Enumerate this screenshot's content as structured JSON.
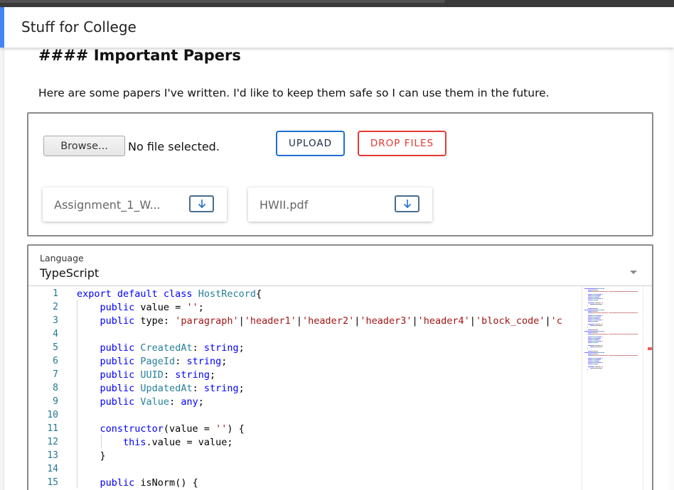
{
  "header": {
    "title": "Stuff for College"
  },
  "main": {
    "heading": "#### Important Papers",
    "intro": "Here are some papers I've written. I'd like to keep them safe so I can use them in the future."
  },
  "upload": {
    "browse_label": "Browse...",
    "no_file_text": "No file selected.",
    "upload_label": "UPLOAD",
    "drop_label": "DROP FILES",
    "files": [
      {
        "name": "Assignment_1_W...",
        "icon": "download-arrow-icon"
      },
      {
        "name": "HWII.pdf",
        "icon": "download-arrow-icon"
      }
    ]
  },
  "editor": {
    "language_label": "Language",
    "language_value": "TypeScript",
    "line_numbers": [
      "1",
      "2",
      "3",
      "4",
      "5",
      "6",
      "7",
      "8",
      "9",
      "10",
      "11",
      "12",
      "13",
      "14",
      "15"
    ],
    "code_lines": [
      [
        [
          "kw",
          "export default class "
        ],
        [
          "ty",
          "HostRecord"
        ],
        [
          "",
          "{"
        ]
      ],
      [
        [
          "",
          "    "
        ],
        [
          "kw",
          "public "
        ],
        [
          "",
          "value = "
        ],
        [
          "st",
          "''"
        ],
        [
          "",
          ";"
        ]
      ],
      [
        [
          "",
          "    "
        ],
        [
          "kw",
          "public "
        ],
        [
          "",
          "type: "
        ],
        [
          "st",
          "'paragraph'"
        ],
        [
          "",
          "|"
        ],
        [
          "st",
          "'header1'"
        ],
        [
          "",
          "|"
        ],
        [
          "st",
          "'header2'"
        ],
        [
          "",
          "|"
        ],
        [
          "st",
          "'header3'"
        ],
        [
          "",
          "|"
        ],
        [
          "st",
          "'header4'"
        ],
        [
          "",
          "|"
        ],
        [
          "st",
          "'block_code'"
        ],
        [
          "",
          "|"
        ],
        [
          "st",
          "'c"
        ]
      ],
      [],
      [
        [
          "",
          "    "
        ],
        [
          "kw",
          "public "
        ],
        [
          "ty",
          "CreatedAt"
        ],
        [
          "",
          ": "
        ],
        [
          "kw",
          "string"
        ],
        [
          "",
          ";"
        ]
      ],
      [
        [
          "",
          "    "
        ],
        [
          "kw",
          "public "
        ],
        [
          "ty",
          "PageId"
        ],
        [
          "",
          ": "
        ],
        [
          "kw",
          "string"
        ],
        [
          "",
          ";"
        ]
      ],
      [
        [
          "",
          "    "
        ],
        [
          "kw",
          "public "
        ],
        [
          "ty",
          "UUID"
        ],
        [
          "",
          ": "
        ],
        [
          "kw",
          "string"
        ],
        [
          "",
          ";"
        ]
      ],
      [
        [
          "",
          "    "
        ],
        [
          "kw",
          "public "
        ],
        [
          "ty",
          "UpdatedAt"
        ],
        [
          "",
          ": "
        ],
        [
          "kw",
          "string"
        ],
        [
          "",
          ";"
        ]
      ],
      [
        [
          "",
          "    "
        ],
        [
          "kw",
          "public "
        ],
        [
          "ty",
          "Value"
        ],
        [
          "",
          ": "
        ],
        [
          "kw",
          "any"
        ],
        [
          "",
          ";"
        ]
      ],
      [],
      [
        [
          "",
          "    "
        ],
        [
          "kw",
          "constructor"
        ],
        [
          "",
          "(value = "
        ],
        [
          "st",
          "''"
        ],
        [
          "",
          ") {"
        ]
      ],
      [
        [
          "",
          "        "
        ],
        [
          "kw",
          "this"
        ],
        [
          "",
          ".value = value;"
        ]
      ],
      [
        [
          "",
          "    }"
        ]
      ],
      [],
      [
        [
          "",
          "    "
        ],
        [
          "kw",
          "public "
        ],
        [
          "",
          "isNorm() {"
        ]
      ]
    ],
    "colors": {
      "keyword": "#0000ff",
      "type": "#267f99",
      "string": "#a31515",
      "line_number": "#237893"
    }
  },
  "colors": {
    "accent": "#4285f4",
    "upload_border": "#1e6fd0",
    "drop_red": "#e53935"
  }
}
